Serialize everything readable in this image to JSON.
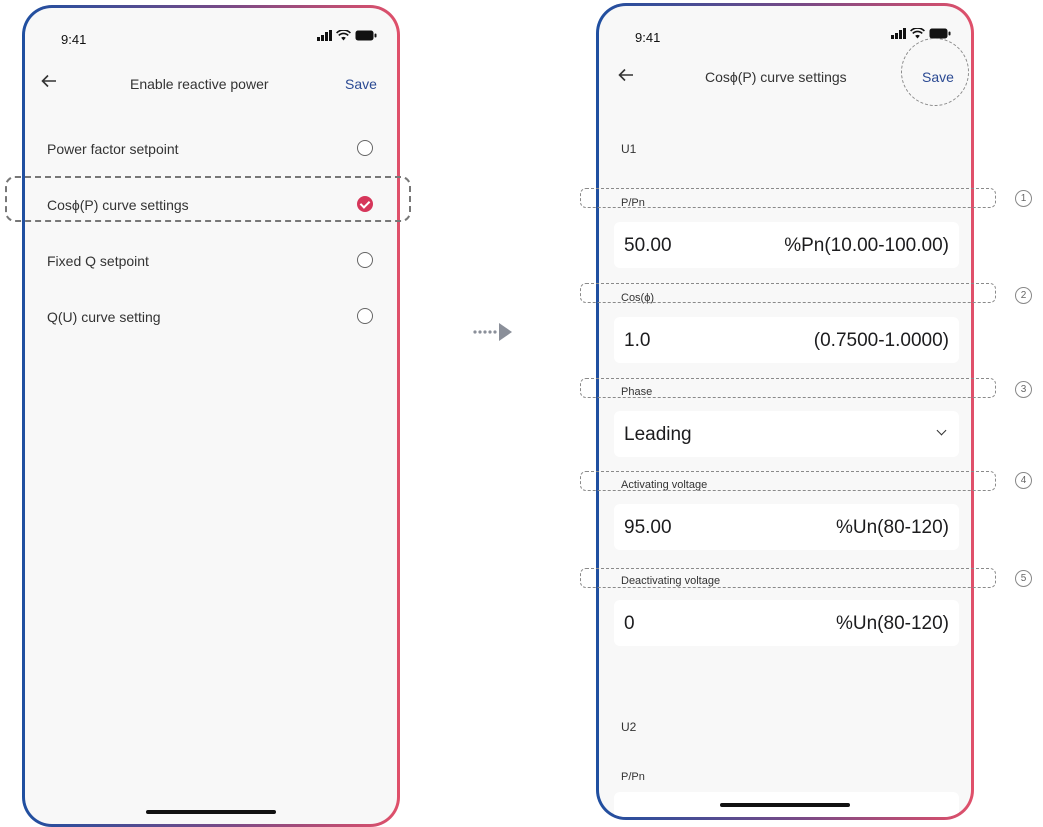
{
  "left_screen": {
    "status_time": "9:41",
    "title": "Enable reactive power",
    "save_label": "Save",
    "options": [
      {
        "label": "Power factor setpoint",
        "selected": false
      },
      {
        "label": "Cosϕ(P) curve settings",
        "selected": true
      },
      {
        "label": "Fixed Q setpoint",
        "selected": false
      },
      {
        "label": "Q(U) curve setting",
        "selected": false
      }
    ]
  },
  "right_screen": {
    "status_time": "9:41",
    "title": "Cosϕ(P) curve settings",
    "save_label": "Save",
    "section_u1": "U1",
    "fields": [
      {
        "label": "P/Pn",
        "value": "50.00",
        "range": "%Pn(10.00-100.00)",
        "callout": "1"
      },
      {
        "label": "Cos(ϕ)",
        "value": "1.0",
        "range": "(0.7500-1.0000)",
        "callout": "2"
      },
      {
        "label": "Phase",
        "value": "Leading",
        "range": "",
        "callout": "3"
      },
      {
        "label": "Activating voltage",
        "value": "95.00",
        "range": "%Un(80-120)",
        "callout": "4"
      },
      {
        "label": "Deactivating voltage",
        "value": "0",
        "range": "%Un(80-120)",
        "callout": "5"
      }
    ],
    "section_u2": "U2",
    "u2_first_label": "P/Pn"
  },
  "colors": {
    "accent_blue": "#2b4a93",
    "accent_red": "#d6365a",
    "frame_left": "#1f4fa0",
    "frame_right": "#e0506a"
  },
  "icons": {
    "back": "arrow-left-icon",
    "signal": "cellular-signal-icon",
    "wifi": "wifi-icon",
    "battery": "battery-icon",
    "dropdown": "chevron-down-icon",
    "flow_arrow": "arrow-right-icon"
  }
}
